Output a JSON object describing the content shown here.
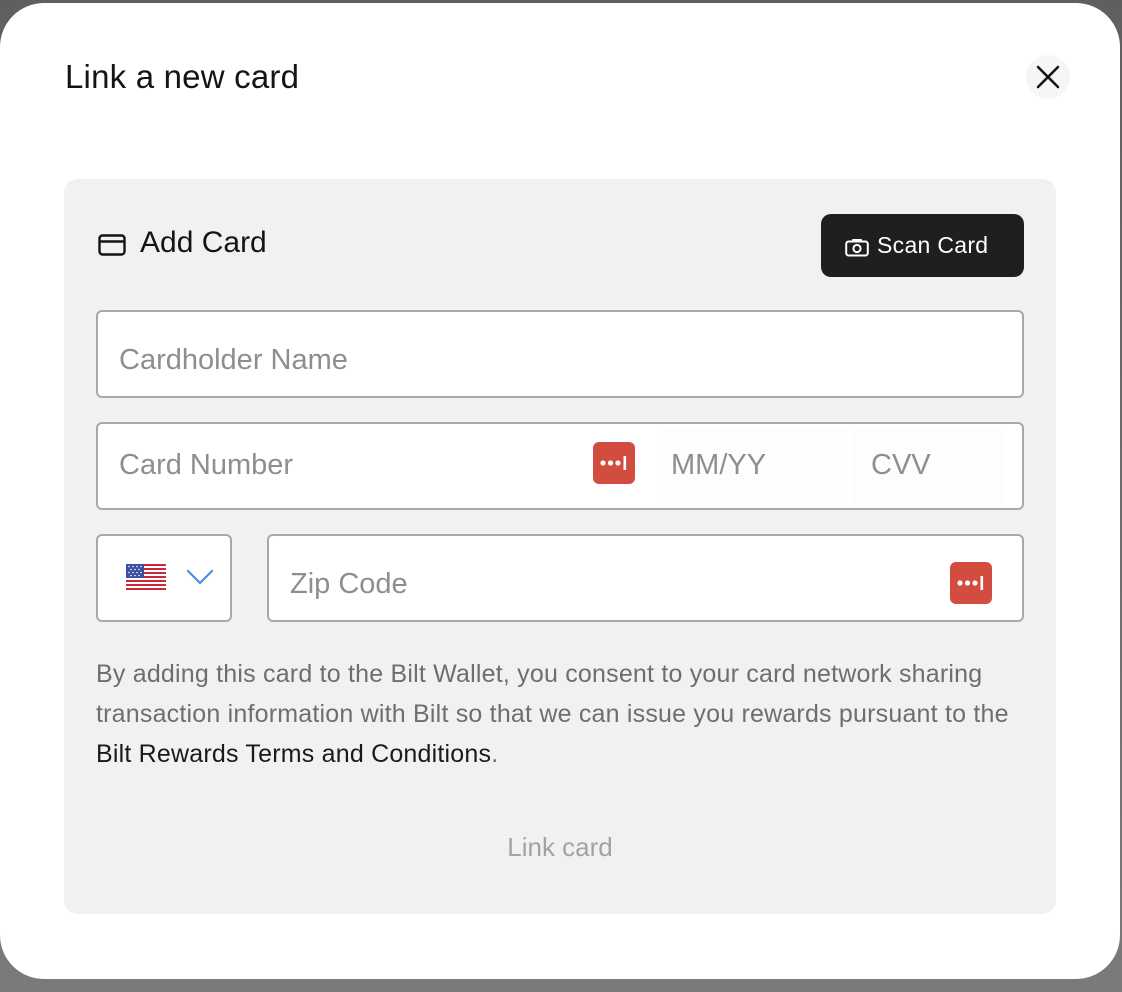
{
  "modal": {
    "title": "Link a new card",
    "close_icon": "close-icon"
  },
  "panel": {
    "title": "Add Card",
    "header_icon": "credit-card-icon",
    "scan_button": {
      "label": "Scan Card",
      "icon": "camera-icon"
    }
  },
  "fields": {
    "cardholder_name": {
      "placeholder": "Cardholder Name",
      "value": ""
    },
    "card_number": {
      "placeholder": "Card Number",
      "value": ""
    },
    "expiry": {
      "placeholder": "MM/YY",
      "value": ""
    },
    "cvv": {
      "placeholder": "CVV",
      "value": ""
    },
    "country": {
      "selected": "United States",
      "icon": "us-flag-icon"
    },
    "zip": {
      "placeholder": "Zip Code",
      "value": ""
    },
    "password_manager_icon": "password-manager-icon"
  },
  "consent": {
    "text_before": "By adding this card to the Bilt Wallet, you consent to your card network sharing transaction information with Bilt so that we can issue you rewards pursuant to the ",
    "link_text": "Bilt Rewards Terms and Conditions",
    "text_after": "."
  },
  "actions": {
    "link_card_label": "Link card"
  },
  "colors": {
    "panel_bg": "#f1f1f2",
    "scan_button_bg": "#1f1f1f",
    "password_icon_bg": "#d24d3f",
    "disabled_text": "#a3a3a6",
    "chevron": "#4a90e2"
  }
}
